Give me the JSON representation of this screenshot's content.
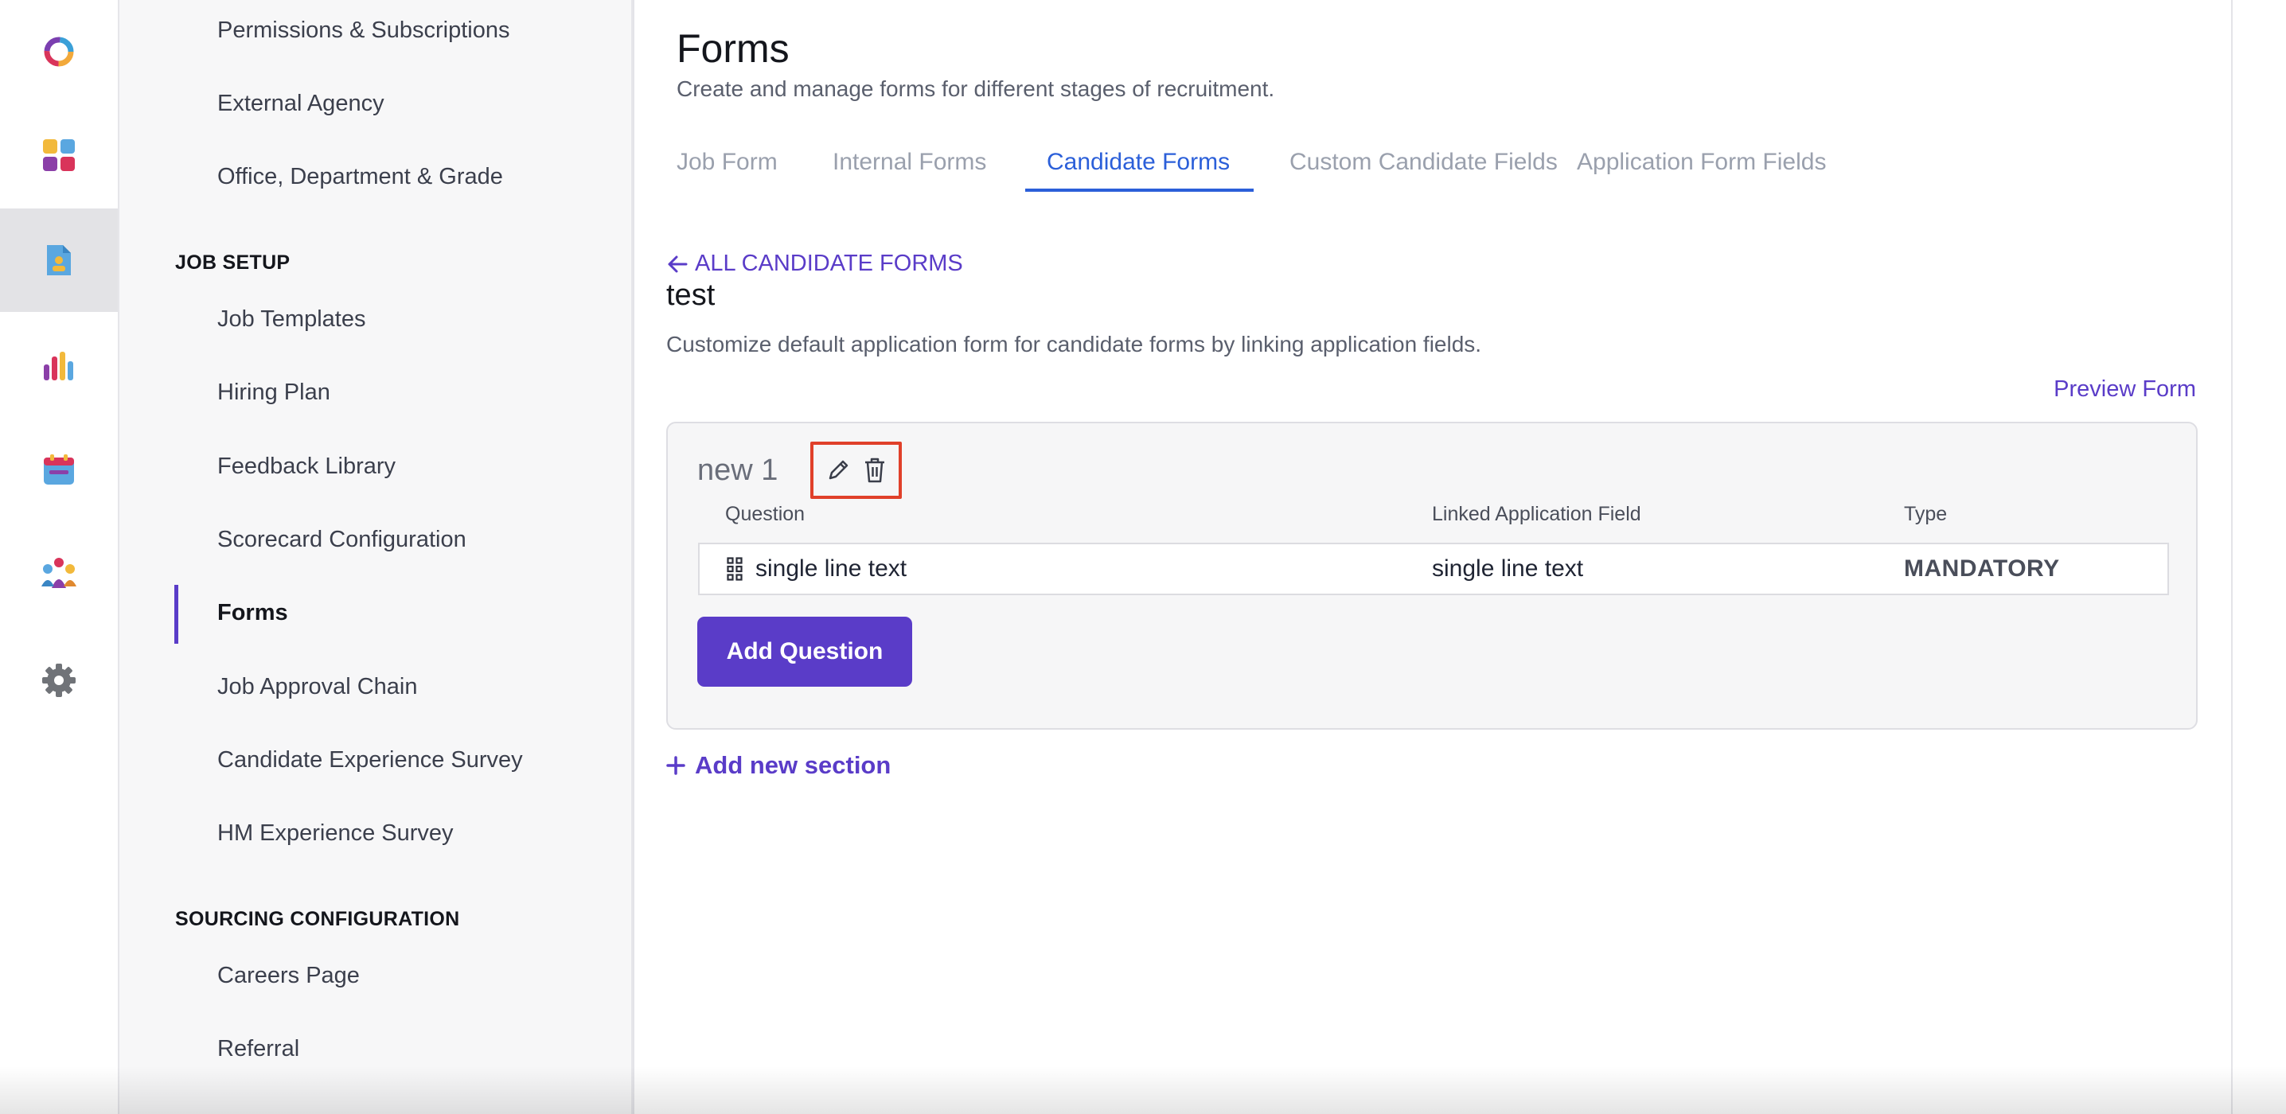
{
  "rail": {
    "items": [
      {
        "icon": "brand-logo-icon",
        "active": false
      },
      {
        "icon": "dashboard-icon",
        "active": false
      },
      {
        "icon": "job-document-icon",
        "active": true
      },
      {
        "icon": "analytics-icon",
        "active": false
      },
      {
        "icon": "calendar-icon",
        "active": false
      },
      {
        "icon": "people-icon",
        "active": false
      },
      {
        "icon": "gear-icon",
        "active": false
      }
    ]
  },
  "sidenav": {
    "top_items": [
      "Permissions & Subscriptions",
      "External Agency",
      "Office, Department & Grade"
    ],
    "job_setup_header": "JOB SETUP",
    "job_setup_items": [
      "Job Templates",
      "Hiring Plan",
      "Feedback Library",
      "Scorecard Configuration",
      "Forms",
      "Job Approval Chain",
      "Candidate Experience Survey",
      "HM Experience Survey"
    ],
    "active_item": "Forms",
    "sourcing_header": "SOURCING CONFIGURATION",
    "sourcing_items": [
      "Careers Page",
      "Referral"
    ]
  },
  "main": {
    "title": "Forms",
    "subtitle": "Create and manage forms for different stages of recruitment.",
    "tabs": [
      "Job Form",
      "Internal Forms",
      "Candidate Forms",
      "Custom Candidate Fields",
      "Application Form Fields"
    ],
    "active_tab": "Candidate Forms",
    "back_link": "ALL CANDIDATE FORMS",
    "form_name": "test",
    "form_description": "Customize default application form for candidate forms by linking application fields.",
    "preview_link": "Preview Form",
    "section": {
      "title": "new 1",
      "columns": [
        "Question",
        "Linked Application Field",
        "Type"
      ],
      "rows": [
        {
          "question": "single line text",
          "linked_field": "single line text",
          "type": "MANDATORY"
        }
      ],
      "add_question_label": "Add Question"
    },
    "add_section_label": "Add new section"
  },
  "colors": {
    "accent": "#5a3cc8",
    "tab_active": "#2b5fd9",
    "highlight_box": "#e0402a"
  }
}
